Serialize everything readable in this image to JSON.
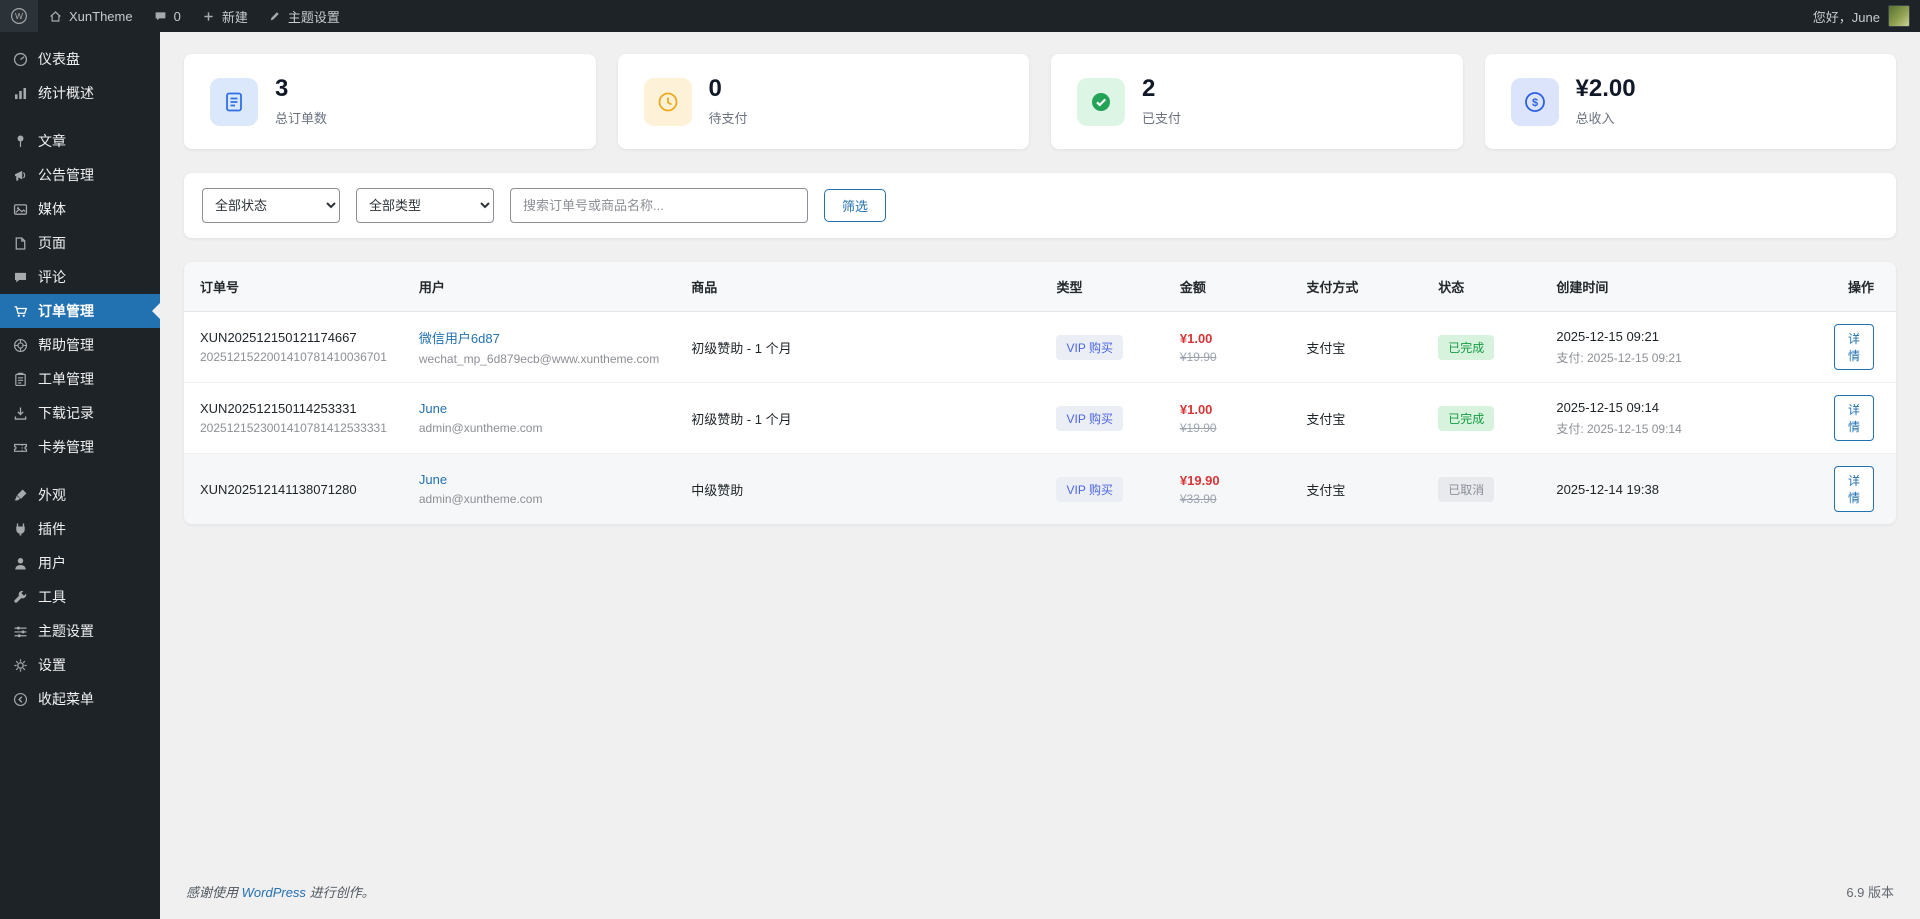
{
  "admin_bar": {
    "site_name": "XunTheme",
    "comments_count": "0",
    "new_label": "新建",
    "theme_settings_label": "主题设置",
    "greeting": "您好，June"
  },
  "sidebar": {
    "items": [
      {
        "label": "仪表盘"
      },
      {
        "label": "统计概述"
      },
      {
        "label": "文章"
      },
      {
        "label": "公告管理"
      },
      {
        "label": "媒体"
      },
      {
        "label": "页面"
      },
      {
        "label": "评论"
      },
      {
        "label": "订单管理"
      },
      {
        "label": "帮助管理"
      },
      {
        "label": "工单管理"
      },
      {
        "label": "下载记录"
      },
      {
        "label": "卡券管理"
      },
      {
        "label": "外观"
      },
      {
        "label": "插件"
      },
      {
        "label": "用户"
      },
      {
        "label": "工具"
      },
      {
        "label": "主题设置"
      },
      {
        "label": "设置"
      },
      {
        "label": "收起菜单"
      }
    ]
  },
  "stats": {
    "cards": [
      {
        "value": "3",
        "label": "总订单数"
      },
      {
        "value": "0",
        "label": "待支付"
      },
      {
        "value": "2",
        "label": "已支付"
      },
      {
        "value": "¥2.00",
        "label": "总收入"
      }
    ]
  },
  "filters": {
    "status_select": "全部状态",
    "type_select": "全部类型",
    "search_placeholder": "搜索订单号或商品名称...",
    "filter_button": "筛选"
  },
  "orders_table": {
    "headers": [
      "订单号",
      "用户",
      "商品",
      "类型",
      "金额",
      "支付方式",
      "状态",
      "创建时间",
      "操作"
    ],
    "rows": [
      {
        "order_no": "XUN202512150121174667",
        "trade_no": "2025121522001410781410036701",
        "user_name": "微信用户6d87",
        "user_email": "wechat_mp_6d879ecb@www.xuntheme.com",
        "product": "初级赞助 - 1 个月",
        "type": "VIP 购买",
        "amount": "¥1.00",
        "original_amount": "¥19.90",
        "payment_method": "支付宝",
        "status": "已完成",
        "created_at": "2025-12-15 09:21",
        "paid_at": "支付: 2025-12-15 09:21",
        "action": "详情"
      },
      {
        "order_no": "XUN202512150114253331",
        "trade_no": "2025121523001410781412533331",
        "user_name": "June",
        "user_email": "admin@xuntheme.com",
        "product": "初级赞助 - 1 个月",
        "type": "VIP 购买",
        "amount": "¥1.00",
        "original_amount": "¥19.90",
        "payment_method": "支付宝",
        "status": "已完成",
        "created_at": "2025-12-15 09:14",
        "paid_at": "支付: 2025-12-15 09:14",
        "action": "详情"
      },
      {
        "order_no": "XUN202512141138071280",
        "user_name": "June",
        "user_email": "admin@xuntheme.com",
        "product": "中级赞助",
        "type": "VIP 购买",
        "amount": "¥19.90",
        "original_amount": "¥33.90",
        "payment_method": "支付宝",
        "status": "已取消",
        "created_at": "2025-12-14 19:38",
        "action": "详情"
      }
    ]
  },
  "footer": {
    "thanks_prefix": "感谢使用",
    "wordpress_link": "WordPress",
    "thanks_suffix": "进行创作。",
    "version": "6.9 版本"
  },
  "colors": {
    "accent": "#2271b1",
    "admin_bar_bg": "#1d2327",
    "content_bg": "#f0f0f1",
    "price_red": "#d63638",
    "status_completed_text": "#189b44",
    "status_completed_bg": "#d7f3de",
    "status_cancelled_text": "#8a8f98",
    "status_cancelled_bg": "#e9eaee",
    "type_badge_text": "#4c66e0",
    "type_badge_bg": "#eceef6"
  }
}
